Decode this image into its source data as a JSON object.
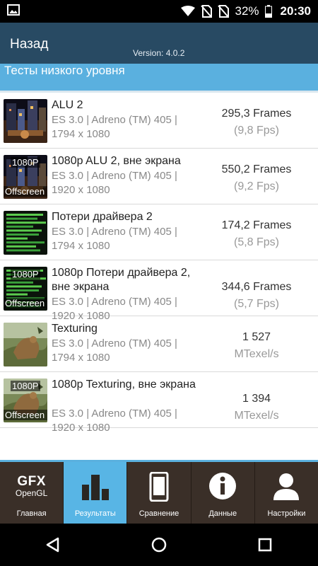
{
  "status_bar": {
    "battery": "32%",
    "time": "20:30"
  },
  "header": {
    "back_label": "Назад",
    "version": "Version: 4.0.2"
  },
  "section": {
    "title": "Тесты низкого уровня"
  },
  "tests": [
    {
      "title": "ALU 2",
      "api": "ES 3.0 | Adreno (TM) 405 |",
      "resolution": "1794 x 1080",
      "result_main": "295,3 Frames",
      "result_sub": "(9,8 Fps)",
      "thumb_top_label": "",
      "thumb_bottom_label": "",
      "thumb_kind": "city"
    },
    {
      "title": "1080p ALU 2, вне экрана",
      "api": "ES 3.0 | Adreno (TM) 405 |",
      "resolution": "1920 x 1080",
      "result_main": "550,2 Frames",
      "result_sub": "(9,2 Fps)",
      "thumb_top_label": "1080P",
      "thumb_bottom_label": "Offscreen",
      "thumb_kind": "city"
    },
    {
      "title": "Потери драйвера 2",
      "api": "ES 3.0 | Adreno (TM) 405 |",
      "resolution": "1794 x 1080",
      "result_main": "174,2 Frames",
      "result_sub": "(5,8 Fps)",
      "thumb_top_label": "",
      "thumb_bottom_label": "",
      "thumb_kind": "bars"
    },
    {
      "title": "1080p Потери драйвера 2, вне экрана",
      "api": "ES 3.0 | Adreno (TM) 405 |",
      "resolution": "1920 x 1080",
      "result_main": "344,6 Frames",
      "result_sub": "(5,7 Fps)",
      "thumb_top_label": "1080P",
      "thumb_bottom_label": "Offscreen",
      "thumb_kind": "bars"
    },
    {
      "title": "Texturing",
      "api": "ES 3.0 | Adreno (TM) 405 |",
      "resolution": "1794 x 1080",
      "result_main": "1 527",
      "result_sub": "MTexel/s",
      "thumb_top_label": "",
      "thumb_bottom_label": "",
      "thumb_kind": "dino"
    },
    {
      "title": "1080p Texturing, вне экрана",
      "api": "ES 3.0 | Adreno (TM) 405 |",
      "resolution": "1920 x 1080",
      "result_main": "1 394",
      "result_sub": "MTexel/s",
      "thumb_top_label": "1080P",
      "thumb_bottom_label": "Offscreen",
      "thumb_kind": "dino"
    }
  ],
  "tabs": [
    {
      "label": "Главная",
      "logo_line1": "GFX",
      "logo_line2": "OpenGL",
      "icon": "gfx-logo-icon",
      "active": false
    },
    {
      "label": "Результаты",
      "icon": "bar-chart-icon",
      "active": true
    },
    {
      "label": "Сравнение",
      "icon": "phone-icon",
      "active": false
    },
    {
      "label": "Данные",
      "icon": "info-icon",
      "active": false
    },
    {
      "label": "Настройки",
      "icon": "person-icon",
      "active": false
    }
  ],
  "navigation": {
    "back": "back-icon",
    "home": "home-icon",
    "recents": "recents-icon"
  },
  "colors": {
    "header": "#284a63",
    "section_band": "#5ab0df",
    "tab_bar": "#3a2f28",
    "tab_active": "#58b5e5"
  }
}
